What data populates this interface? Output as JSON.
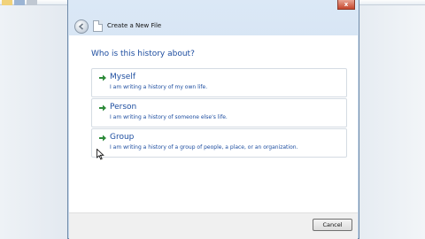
{
  "dialog": {
    "title": "Create a New File",
    "close_label": "x",
    "question": "Who is this history about?",
    "options": [
      {
        "title": "Myself",
        "description": "I am writing a history of my own life."
      },
      {
        "title": "Person",
        "description": "I am writing a history of someone else's life."
      },
      {
        "title": "Group",
        "description": "I am writing a history of a group of people, a place, or an organization."
      }
    ],
    "cancel_label": "Cancel"
  },
  "icons": {
    "back": "back-arrow-icon",
    "file": "document-icon",
    "option_arrow": "green-arrow-icon",
    "cursor": "mouse-pointer-icon"
  },
  "colors": {
    "accent_text": "#1e4ea0",
    "arrow_green": "#2e8b3a",
    "close_red": "#c5462c"
  }
}
